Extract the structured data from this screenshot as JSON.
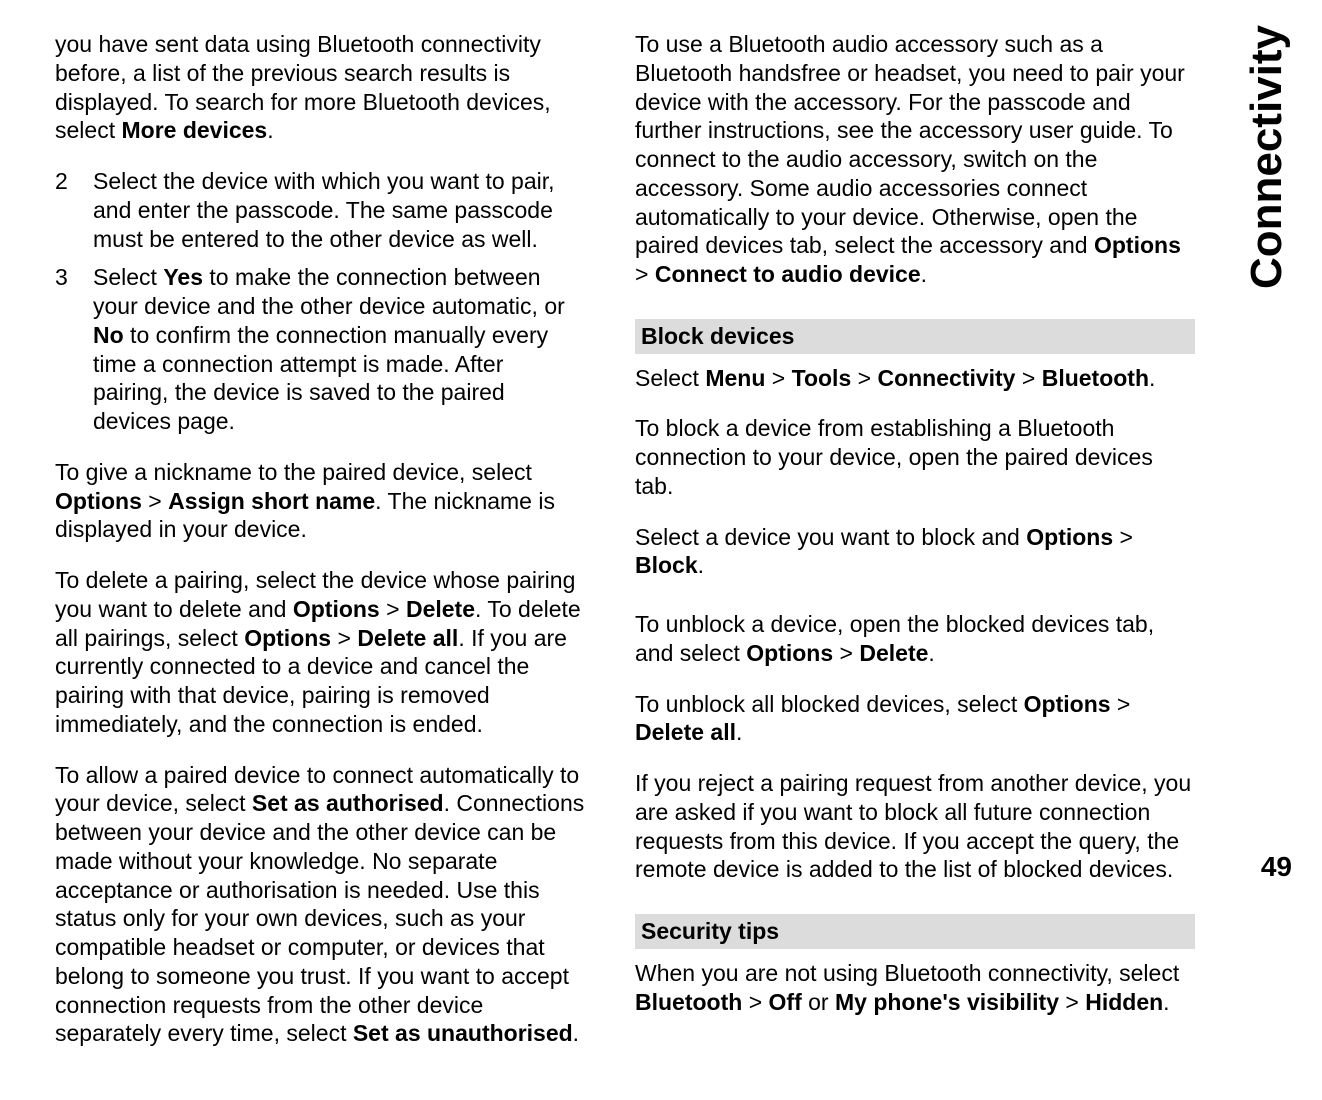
{
  "sideLabel": "Connectivity",
  "pageNumber": "49",
  "left": {
    "intro": {
      "text1": "you have sent data using Bluetooth connectivity before, a list of the previous search results is displayed. To search for more Bluetooth devices, select ",
      "bold1": "More devices",
      "text2": "."
    },
    "step2": {
      "num": "2",
      "text": "Select the device with which you want to pair, and enter the passcode. The same passcode must be entered to the other device as well."
    },
    "step3": {
      "num": "3",
      "t1": "Select ",
      "b1": "Yes",
      "t2": " to make the connection between your device and the other device automatic, or ",
      "b2": "No",
      "t3": " to confirm the connection manually every time a connection attempt is made. After pairing, the device is saved to the paired devices page."
    },
    "nickname": {
      "t1": "To give a nickname to the paired device, select ",
      "b1": "Options",
      "t2": " > ",
      "b2": "Assign short name",
      "t3": ". The nickname is displayed in your device."
    },
    "deletePairing": {
      "t1": "To delete a pairing, select the device whose pairing you want to delete and ",
      "b1": "Options",
      "t2": " > ",
      "b2": "Delete",
      "t3": ". To delete all pairings, select ",
      "b3": "Options",
      "t4": " > ",
      "b4": "Delete all",
      "t5": ". If you are currently connected to a device and cancel the pairing with that device, pairing is removed immediately, and the connection is ended."
    },
    "authorised": {
      "t1": "To allow a paired device to connect automatically to your device, select ",
      "b1": "Set as authorised",
      "t2": ". Connections between your device and the other device can be made without your knowledge. No separate acceptance or authorisation is needed. Use this status only for your own devices, such as your compatible headset or computer, or devices that belong to someone you trust. If you want to accept connection requests from the other device separately every time, select ",
      "b2": "Set as unauthorised",
      "t3": "."
    }
  },
  "right": {
    "audio": {
      "t1": "To use a Bluetooth audio accessory such as a Bluetooth handsfree or headset, you need to pair your device with the accessory. For the passcode and further instructions, see the accessory user guide. To connect to the audio accessory, switch on the accessory. Some audio accessories connect automatically to your device. Otherwise, open the paired devices tab, select the accessory and ",
      "b1": "Options",
      "t2": " > ",
      "b2": "Connect to audio device",
      "t3": "."
    },
    "headingBlock": "Block devices",
    "blockPath": {
      "t1": "Select ",
      "b1": "Menu",
      "t2": " > ",
      "b2": "Tools",
      "t3": " > ",
      "b3": "Connectivity",
      "t4": " > ",
      "b4": "Bluetooth",
      "t5": "."
    },
    "blockIntro": "To block a device from establishing a Bluetooth connection to your device, open the paired devices tab.",
    "blockAction": {
      "t1": "Select a device you want to block and ",
      "b1": "Options",
      "t2": " > ",
      "b2": "Block",
      "t3": "."
    },
    "unblock": {
      "t1": "To unblock a device, open the blocked devices tab, and select ",
      "b1": "Options",
      "t2": " > ",
      "b2": "Delete",
      "t3": "."
    },
    "unblockAll": {
      "t1": "To unblock all blocked devices, select ",
      "b1": "Options",
      "t2": " > ",
      "b2": "Delete all",
      "t3": "."
    },
    "reject": "If you reject a pairing request from another device, you are asked if you want to block all future connection requests from this device. If you accept the query, the remote device is added to the list of blocked devices.",
    "headingSecurity": "Security tips",
    "security": {
      "t1": "When you are not using Bluetooth connectivity, select ",
      "b1": "Bluetooth",
      "t2": " > ",
      "b2": "Off",
      "t3": " or ",
      "b3": "My phone's visibility",
      "t4": " > ",
      "b4": "Hidden",
      "t5": "."
    }
  }
}
